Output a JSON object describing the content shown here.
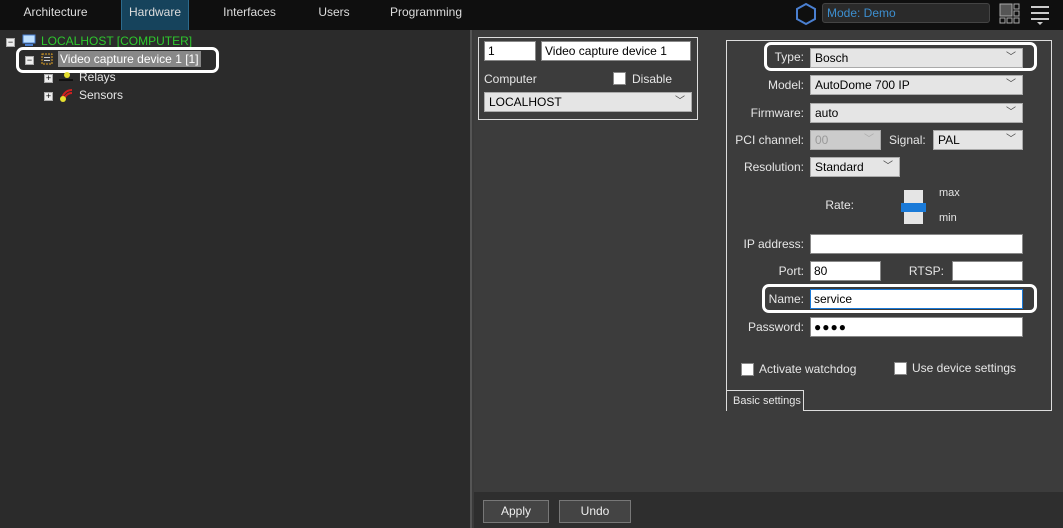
{
  "nav": {
    "tabs": [
      "Architecture",
      "Hardware",
      "Interfaces",
      "Users",
      "Programming"
    ],
    "active": "Hardware",
    "mode": "Mode: Demo"
  },
  "tree": {
    "root": "LOCALHOST [COMPUTER]",
    "device": "Video capture device 1 [1]",
    "children": [
      "Relays",
      "Sensors"
    ]
  },
  "device": {
    "id": "1",
    "name": "Video capture device 1",
    "computer_label": "Computer",
    "disable_label": "Disable",
    "computer": "LOCALHOST"
  },
  "settings": {
    "type_label": "Type:",
    "type": "Bosch",
    "model_label": "Model:",
    "model": "AutoDome 700 IP",
    "firmware_label": "Firmware:",
    "firmware": "auto",
    "pci_label": "PCI channel:",
    "pci": "00",
    "signal_label": "Signal:",
    "signal": "PAL",
    "resolution_label": "Resolution:",
    "resolution": "Standard",
    "rate_label": "Rate:",
    "rate_max": "max",
    "rate_min": "min",
    "rate_value": 0.5,
    "ip_label": "IP address:",
    "ip": "",
    "port_label": "Port:",
    "port": "80",
    "rtsp_label": "RTSP:",
    "rtsp": "",
    "name_label": "Name:",
    "name": "service",
    "password_label": "Password:",
    "password": "●●●●",
    "watchdog_label": "Activate watchdog",
    "use_device_label": "Use device settings",
    "tab": "Basic settings"
  },
  "footer": {
    "apply": "Apply",
    "undo": "Undo"
  }
}
